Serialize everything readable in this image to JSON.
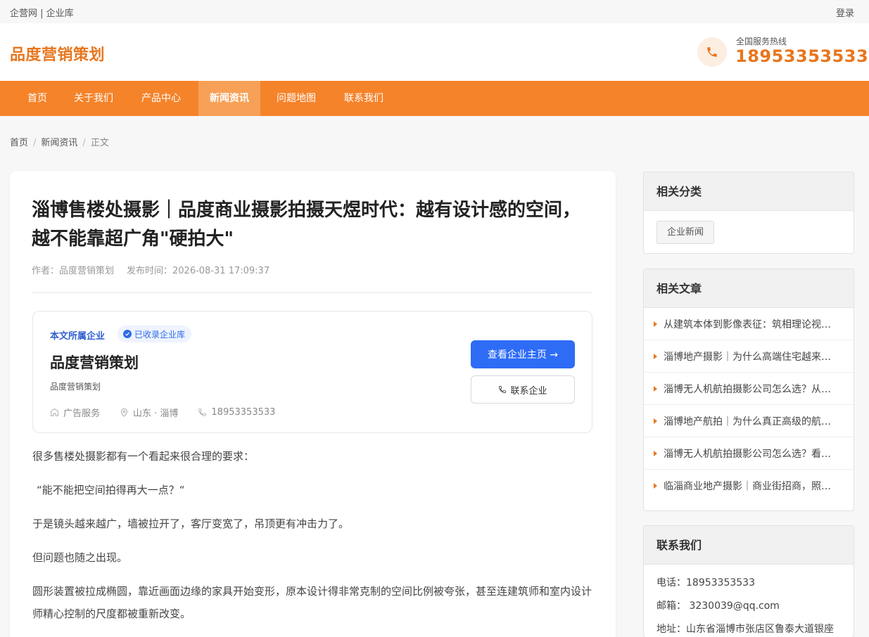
{
  "topbar": {
    "left_text": "企营网 | 企业库",
    "login": "登录"
  },
  "header": {
    "logo": "品度营销策划",
    "hotline_label": "全国服务热线",
    "hotline_number": "18953353533",
    "phone_icon": "phone-icon"
  },
  "nav": {
    "items": [
      {
        "label": "首页"
      },
      {
        "label": "关于我们"
      },
      {
        "label": "产品中心"
      },
      {
        "label": "新闻资讯",
        "active": true
      },
      {
        "label": "问题地图"
      },
      {
        "label": "联系我们"
      }
    ]
  },
  "breadcrumb": {
    "home": "首页",
    "section": "新闻资讯",
    "current": "正文",
    "sep": "/"
  },
  "article": {
    "title": "淄博售楼处摄影｜品度商业摄影拍摄天煜时代：越有设计感的空间，越不能靠超广角\"硬拍大\"",
    "author": "作者：品度营销策划",
    "publish_time": "发布时间：2026-08-31 17:09:37",
    "company_card": {
      "label": "本文所属企业",
      "badge": "已收录企业库",
      "name": "品度营销策划",
      "subname": "品度营销策划",
      "industry": "广告服务",
      "location": "山东 · 淄博",
      "phone": "18953353533",
      "primary_button": "查看企业主页 →",
      "secondary_button": "联系企业"
    },
    "paragraphs": [
      "很多售楼处摄影都有一个看起来很合理的要求：",
      "“能不能把空间拍得再大一点？“",
      "于是镜头越来越广，墙被拉开了，客厅变宽了，吊顶更有冲击力了。",
      "但问题也随之出现。",
      "圆形装置被拉成椭圆，靠近画面边缘的家具开始变形，原本设计得非常克制的空间比例被夸张，甚至连建筑师和室内设计师精心控制的尺度都被重新改变。"
    ]
  },
  "sidebar": {
    "categories": {
      "title": "相关分类",
      "tags": [
        "企业新闻"
      ]
    },
    "related": {
      "title": "相关文章",
      "items": [
        "从建筑本体到影像表征：筑相理论视角下的淄博建筑摄影",
        "淄博地产摄影｜为什么高端住宅越来越重视样板间摄影",
        "淄博无人机航拍摄影公司怎么选？从项目需求出发",
        "淄博地产航拍｜为什么真正高级的航拍是克制的",
        "淄博无人机航拍摄影公司怎么选？看这几点就够了",
        "临淄商业地产摄影｜商业街招商，照片比你想象的更重要"
      ]
    },
    "contact": {
      "title": "联系我们",
      "phone": "电话：18953353533",
      "email": "邮箱： 3230039@qq.com",
      "address": "地址：山东省淄博市张店区鲁泰大道银座"
    }
  },
  "colors": {
    "brand_orange": "#f5832a",
    "logo_orange": "#e8761e",
    "primary_blue": "#2e6cf6"
  }
}
